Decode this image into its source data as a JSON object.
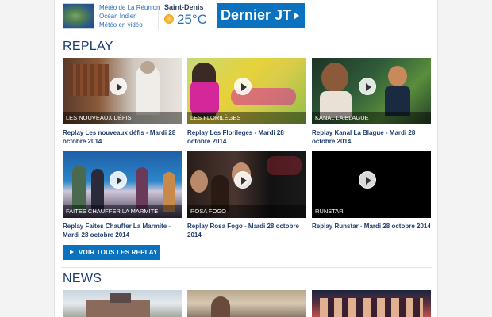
{
  "meteo": {
    "links": [
      "Météo de La Réunion",
      "Océan Indien",
      "Météo en vidéo"
    ],
    "city": "Saint-Denis",
    "temperature": "25°C",
    "icon": "sun-cloud-icon"
  },
  "jt_button": {
    "label": "Dernier JT"
  },
  "replay": {
    "title": "REPLAY",
    "items": [
      {
        "caption": "LES NOUVEAUX DÉFIS",
        "title": "Replay Les nouveaux défis - Mardi 28 octobre 2014"
      },
      {
        "caption": "LES FLORILÈGES",
        "title": "Replay Les Florileges - Mardi 28 octobre 2014"
      },
      {
        "caption": "KANAL LA BLAGUE",
        "title": "Replay Kanal La Blague - Mardi 28 octobre 2014"
      },
      {
        "caption": "FAITES CHAUFFER LA MARMITE",
        "title": "Replay Faites Chauffer La Marmite - Mardi 28 octobre 2014"
      },
      {
        "caption": "ROSA FOGO",
        "title": "Replay Rosa Fogo - Mardi 28 octobre 2014"
      },
      {
        "caption": "RUNSTAR",
        "title": "Replay Runstar - Mardi 28 octobre 2014"
      }
    ],
    "see_all_label": "VOIR TOUS LES REPLAY"
  },
  "news": {
    "title": "NEWS"
  },
  "colors": {
    "accent": "#0b72bf",
    "title": "#1f3c6e",
    "link": "#2b6fb6"
  }
}
